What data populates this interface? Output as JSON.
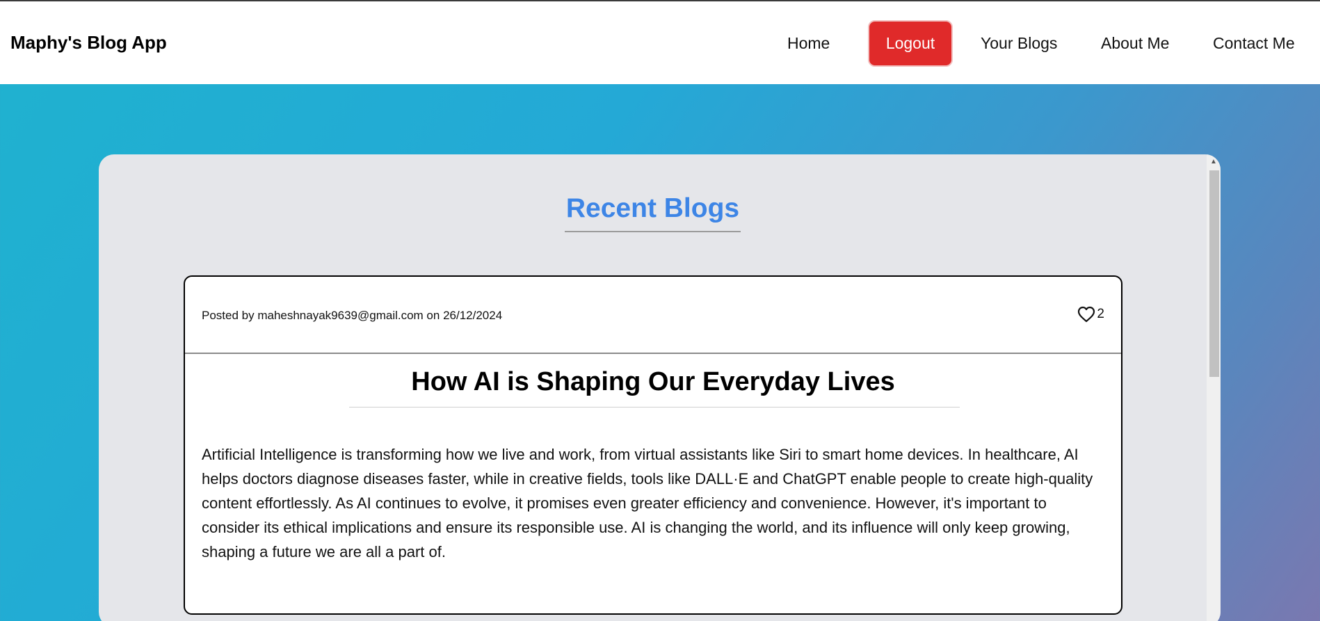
{
  "app": {
    "brand": "Maphy's Blog App"
  },
  "nav": {
    "home": "Home",
    "logout": "Logout",
    "your_blogs": "Your Blogs",
    "about_me": "About Me",
    "contact_me": "Contact Me"
  },
  "main": {
    "section_title": "Recent Blogs",
    "posts": [
      {
        "posted_by_text": "Posted by maheshnayak9639@gmail.com on 26/12/2024",
        "likes": "2",
        "title": "How AI is Shaping Our Everyday Lives",
        "body": "Artificial Intelligence is transforming how we live and work, from virtual assistants like Siri to smart home devices. In healthcare, AI helps doctors diagnose diseases faster, while in creative fields, tools like DALL·E and ChatGPT enable people to create high-quality content effortlessly. As AI continues to evolve, it promises even greater efficiency and convenience. However, it's important to consider its ethical implications and ensure its responsible use. AI is changing the world, and its influence will only keep growing, shaping a future we are all a part of."
      }
    ]
  },
  "colors": {
    "logout_bg": "#e02a2a",
    "section_title": "#3d85e6",
    "panel_bg": "#e5e6ea"
  },
  "icons": {
    "like": "heart-outline-icon",
    "scroll_up": "scroll-up-arrow-icon"
  }
}
